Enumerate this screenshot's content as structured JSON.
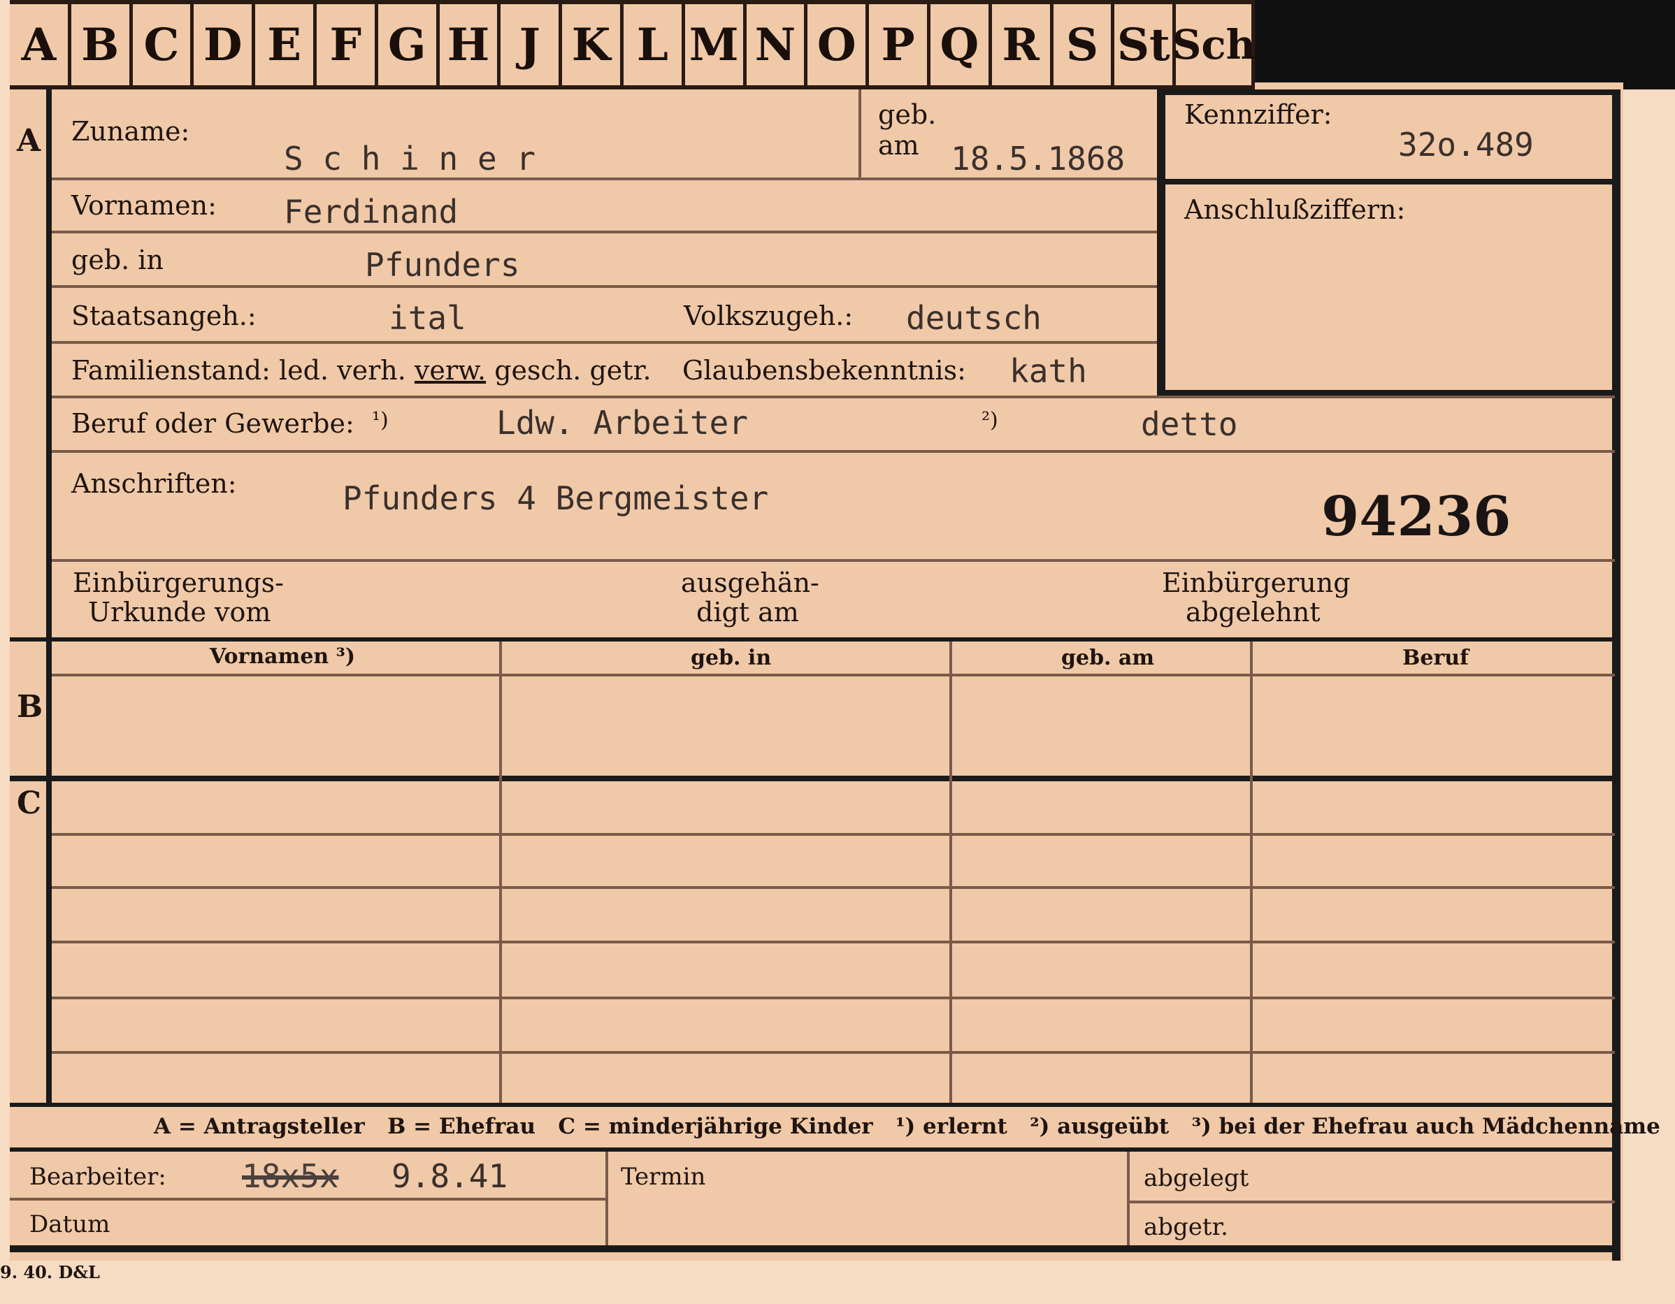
{
  "tabs": [
    "A",
    "B",
    "C",
    "D",
    "E",
    "F",
    "G",
    "H",
    "J",
    "K",
    "L",
    "M",
    "N",
    "O",
    "P",
    "Q",
    "R",
    "S",
    "St",
    "Sch"
  ],
  "section_markers": {
    "a": "A",
    "b": "B",
    "c": "C"
  },
  "labels": {
    "zuname": "Zuname:",
    "geb_am_1": "geb.",
    "geb_am_2": "am",
    "kennziffer": "Kennziffer:",
    "anschlussziffern": "Anschlußziffern:",
    "vornamen": "Vornamen:",
    "geb_in": "geb. in",
    "staatsangeh": "Staatsangeh.:",
    "volkszugeh": "Volkszugeh.:",
    "familienstand": "Familienstand: led. verh.",
    "familienstand_verw": "verw.",
    "familienstand_rest": "gesch. getr.",
    "glaubensbekenntnis": "Glaubensbekenntnis:",
    "beruf": "Beruf oder Gewerbe:",
    "note1": "¹)",
    "note2": "²)",
    "anschriften": "Anschriften:",
    "einb_urkunde_1": "Einbürgerungs-",
    "einb_urkunde_2": "Urkunde vom",
    "ausgehaendigt_1": "ausgehän-",
    "ausgehaendigt_2": "digt am",
    "einb_abgelehnt_1": "Einbürgerung",
    "einb_abgelehnt_2": "abgelehnt"
  },
  "values": {
    "zuname": "S c h i n e r",
    "geb_am": "18.5.1868",
    "kennziffer": "32o.489",
    "vornamen": "Ferdinand",
    "geb_in": "Pfunders",
    "staatsangeh": "ital",
    "volkszugeh": "deutsch",
    "glaubensbekenntnis": "kath",
    "beruf_erlernt": "Ldw. Arbeiter",
    "beruf_ausgeuebt": "detto",
    "anschrift": "Pfunders 4 Bergmeister",
    "stamp_number": "94236"
  },
  "table": {
    "headers": [
      "Vornamen ³)",
      "geb. in",
      "geb. am",
      "Beruf"
    ]
  },
  "legend": "A = Antragsteller   B = Ehefrau   C = minderjährige Kinder   ¹) erlernt   ²) ausgeübt   ³) bei der Ehefrau auch Mädchenname",
  "footer": {
    "bearbeiter_label": "Bearbeiter:",
    "bearbeiter_struck": "18x5x",
    "bearbeiter_date": "9.8.41",
    "datum_label": "Datum",
    "termin_label": "Termin",
    "abgelegt_label": "abgelegt",
    "abgetr_label": "abgetr."
  },
  "print_code": "9. 40. D&L"
}
